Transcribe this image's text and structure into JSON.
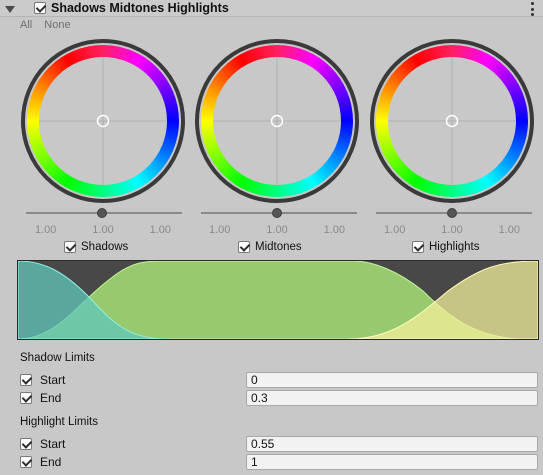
{
  "header": {
    "title": "Shadows Midtones Highlights",
    "enabled": true
  },
  "toggle_all": {
    "all_label": "All",
    "none_label": "None"
  },
  "wheels": [
    {
      "label": "Shadows",
      "checked": true,
      "values": [
        "1.00",
        "1.00",
        "1.00"
      ]
    },
    {
      "label": "Midtones",
      "checked": true,
      "values": [
        "1.00",
        "1.00",
        "1.00"
      ]
    },
    {
      "label": "Highlights",
      "checked": true,
      "values": [
        "1.00",
        "1.00",
        "1.00"
      ]
    }
  ],
  "graph": {
    "colors": {
      "shadows": "#5fc7b9",
      "midtones": "#a6e077",
      "highlights": "#f2ef9a",
      "background": "#484848"
    }
  },
  "shadow_limits": {
    "title": "Shadow Limits",
    "start": {
      "label": "Start",
      "value": "0"
    },
    "end": {
      "label": "End",
      "value": "0.3"
    }
  },
  "highlight_limits": {
    "title": "Highlight Limits",
    "start": {
      "label": "Start",
      "value": "0.55"
    },
    "end": {
      "label": "End",
      "value": "1"
    }
  }
}
